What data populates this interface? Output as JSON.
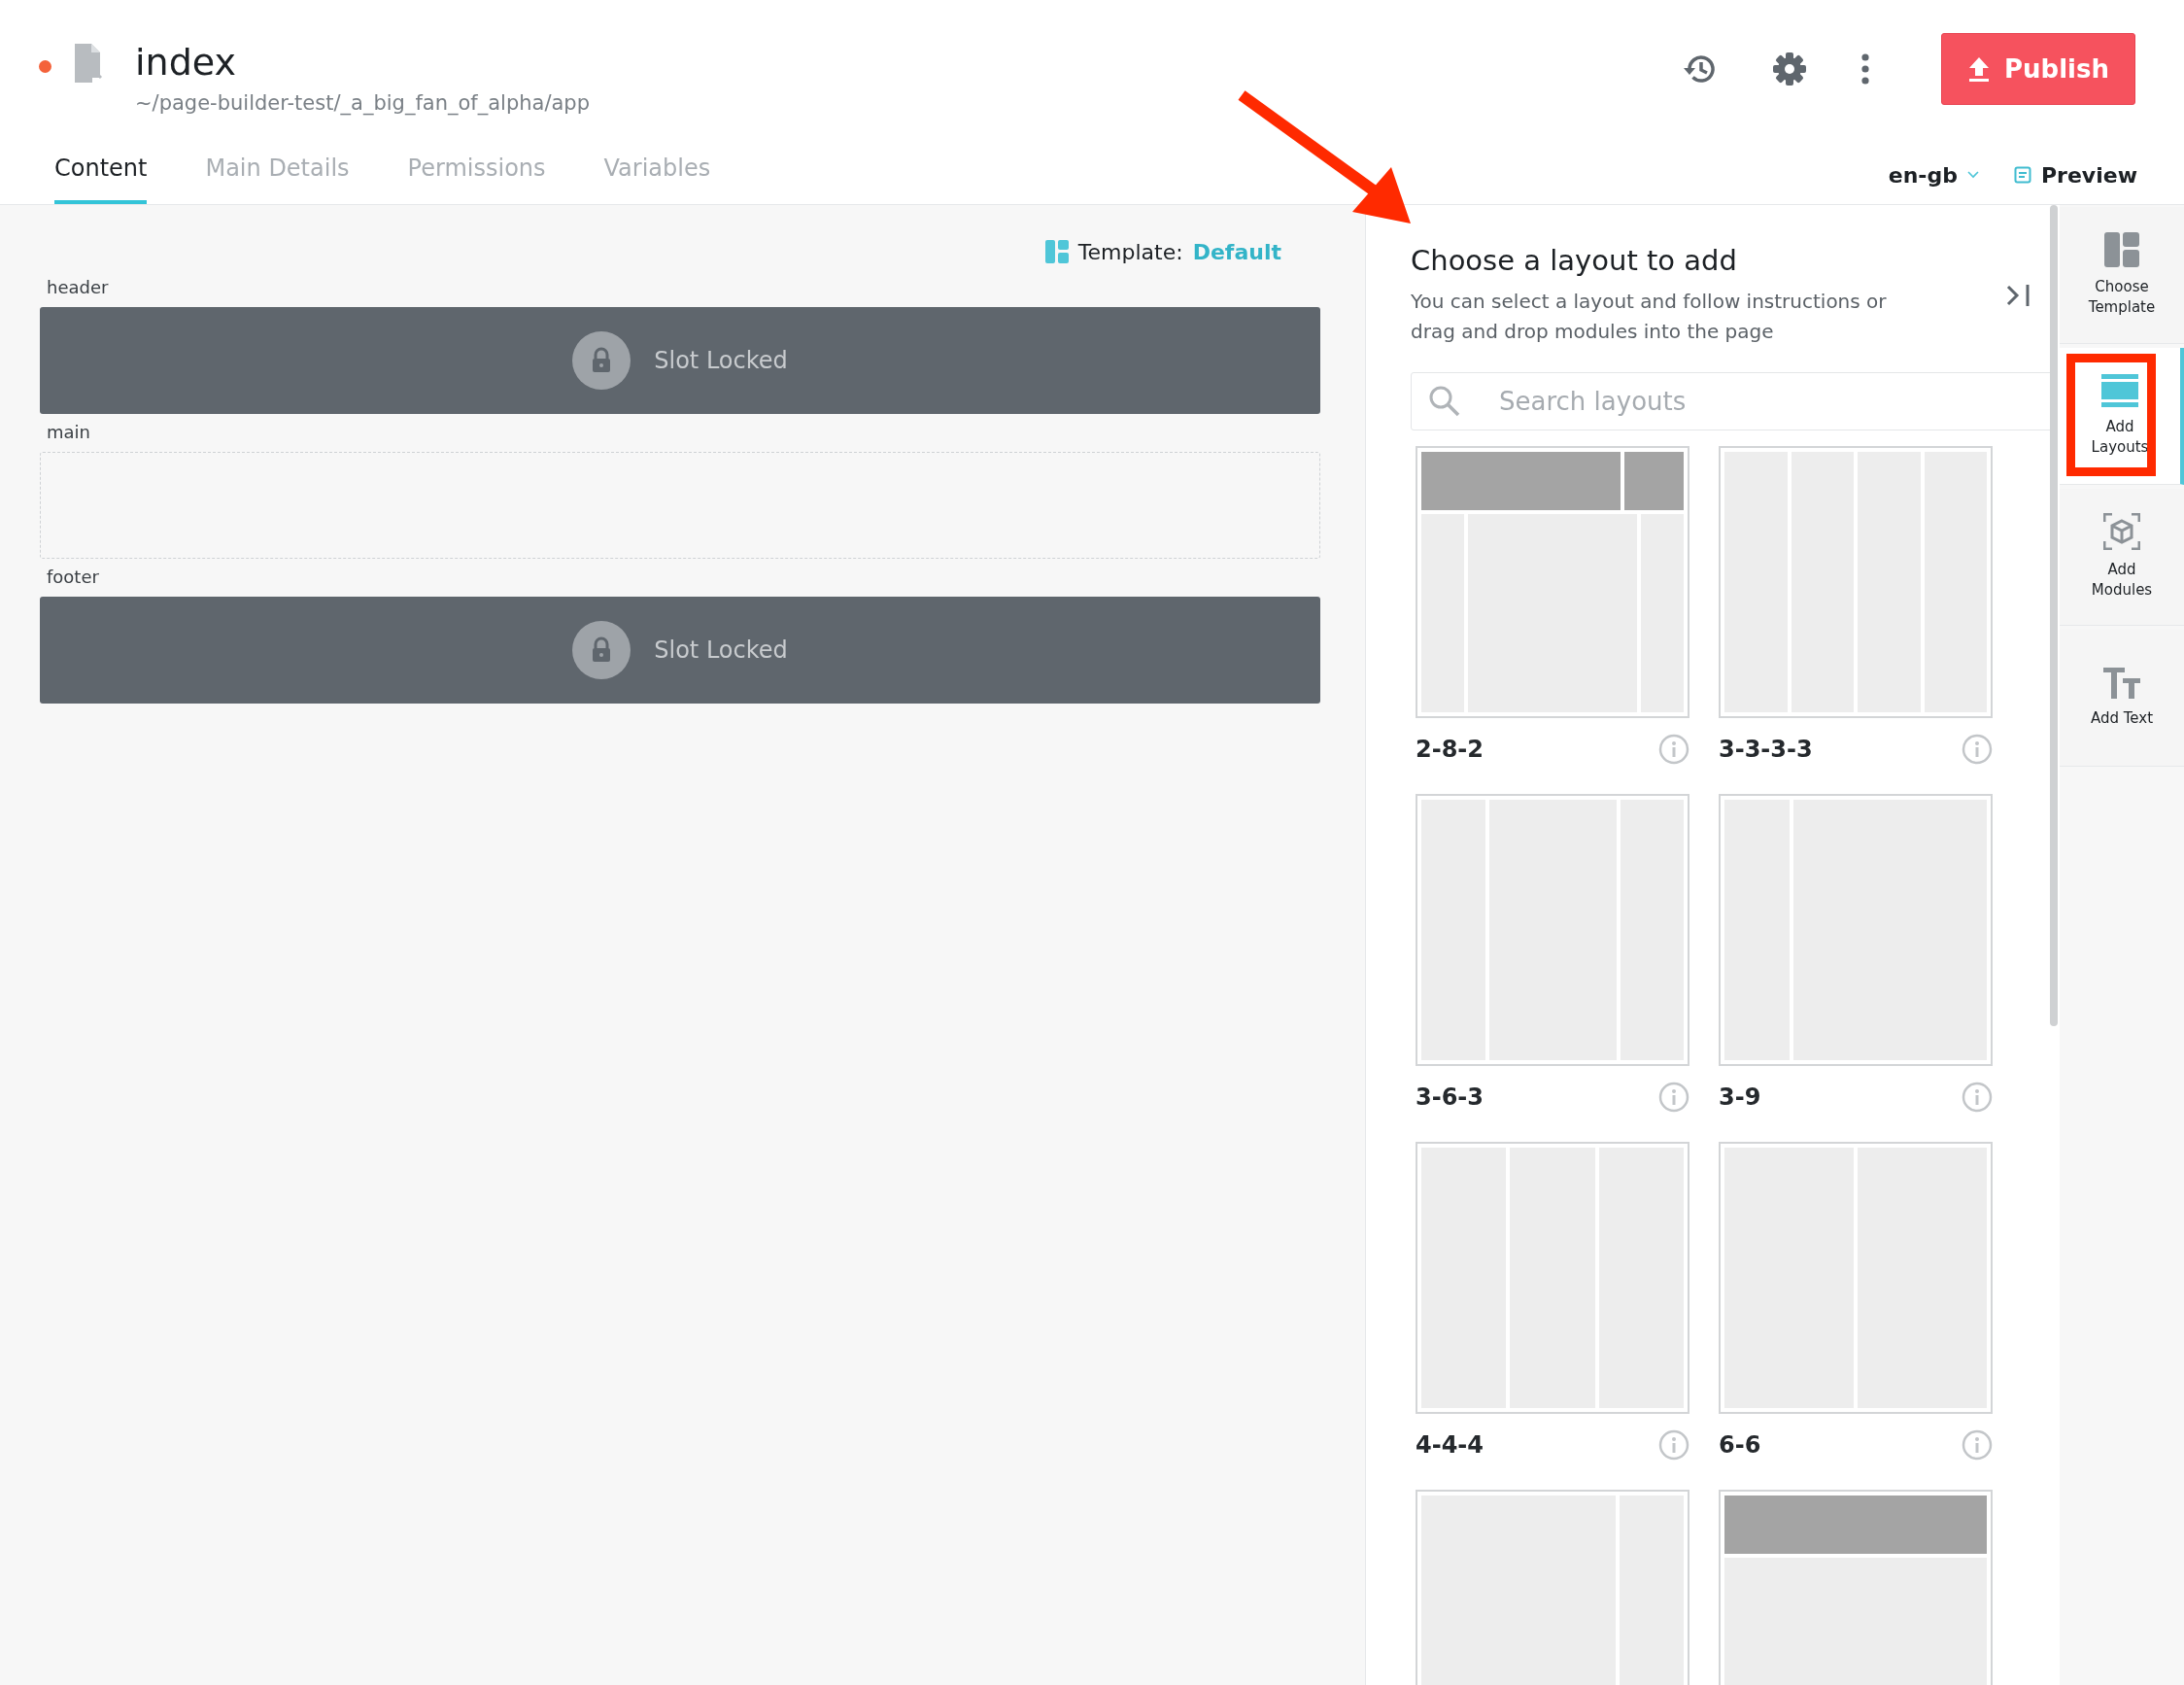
{
  "page": {
    "title": "index",
    "path": "~/page-builder-test/_a_big_fan_of_alpha/app",
    "unsaved": true
  },
  "actions": {
    "publish": "Publish",
    "locale": "en-gb",
    "preview": "Preview"
  },
  "tabs": [
    {
      "label": "Content",
      "selected": true
    },
    {
      "label": "Main Details",
      "selected": false
    },
    {
      "label": "Permissions",
      "selected": false
    },
    {
      "label": "Variables",
      "selected": false
    }
  ],
  "template": {
    "label": "Template:",
    "value": "Default"
  },
  "slots": [
    {
      "name": "header",
      "locked": true,
      "text": "Slot Locked"
    },
    {
      "name": "main",
      "locked": false
    },
    {
      "name": "footer",
      "locked": true,
      "text": "Slot Locked"
    }
  ],
  "panel": {
    "title": "Choose a layout to add",
    "description": "You can select a layout and follow instructions or drag and drop modules into the page",
    "search": {
      "placeholder": "Search layouts"
    },
    "layouts": [
      {
        "label": "2-8-2",
        "kind": "banner"
      },
      {
        "label": "3-3-3-3",
        "kind": "quarters"
      },
      {
        "label": "3-6-3",
        "kind": "centred"
      },
      {
        "label": "3-9",
        "kind": "sidebar"
      },
      {
        "label": "4-4-4",
        "kind": "thirds"
      },
      {
        "label": "6-6",
        "kind": "halves"
      },
      {
        "kind": "aside"
      },
      {
        "kind": "hero"
      }
    ]
  },
  "sidebar": [
    {
      "kind": "template",
      "label": "Choose Template",
      "selected": false
    },
    {
      "kind": "layouts",
      "label": "Add Layouts",
      "selected": true
    },
    {
      "kind": "modules",
      "label": "Add Modules",
      "selected": false
    },
    {
      "kind": "text",
      "label": "Add Text",
      "selected": false
    }
  ]
}
